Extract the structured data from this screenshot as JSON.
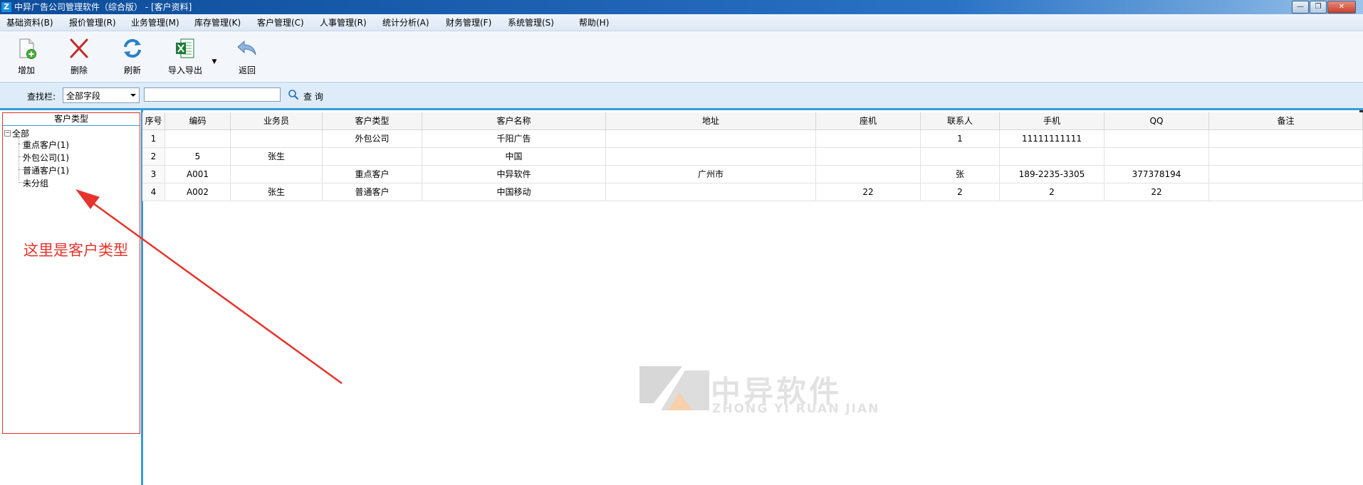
{
  "window": {
    "title": "中异广告公司管理软件（综合版） - [客户资料]",
    "app_icon": "Z",
    "minimize": "—",
    "maximize": "❐",
    "close": "✕"
  },
  "menu": [
    "基础资料(B)",
    "报价管理(R)",
    "业务管理(M)",
    "库存管理(K)",
    "客户管理(C)",
    "人事管理(R)",
    "统计分析(A)",
    "财务管理(F)",
    "系统管理(S)",
    "帮助(H)"
  ],
  "toolbar": {
    "add": "增加",
    "delete": "删除",
    "refresh": "刷新",
    "import_export": "导入导出",
    "back": "返回"
  },
  "search": {
    "label": "查找栏:",
    "field_selected": "全部字段",
    "input_value": "",
    "query_label": "查 询"
  },
  "left_panel": {
    "header": "客户类型",
    "tree": {
      "root": "全部",
      "children": [
        "重点客户(1)",
        "外包公司(1)",
        "普通客户(1)",
        "未分组"
      ]
    },
    "annotation": "这里是客户类型"
  },
  "grid": {
    "columns": [
      "序号",
      "编码",
      "业务员",
      "客户类型",
      "客户名称",
      "地址",
      "座机",
      "联系人",
      "手机",
      "QQ",
      "备注"
    ],
    "rows": [
      [
        "1",
        "",
        "",
        "外包公司",
        "千阳广告",
        "",
        "",
        "1",
        "11111111111",
        "",
        ""
      ],
      [
        "2",
        "5",
        "张生",
        "",
        "中国",
        "",
        "",
        "",
        "",
        "",
        ""
      ],
      [
        "3",
        "A001",
        "",
        "重点客户",
        "中异软件",
        "广州市",
        "",
        "张",
        "189-2235-3305",
        "377378194",
        ""
      ],
      [
        "4",
        "A002",
        "张生",
        "普通客户",
        "中国移动",
        "",
        "22",
        "2",
        "2",
        "22",
        ""
      ]
    ]
  },
  "watermark": {
    "text": "中异软件",
    "subtext": "ZHONG YI RUAN JIAN"
  },
  "colors": {
    "accent_blue": "#3b9ad9",
    "annotation_red": "#e5342c"
  }
}
